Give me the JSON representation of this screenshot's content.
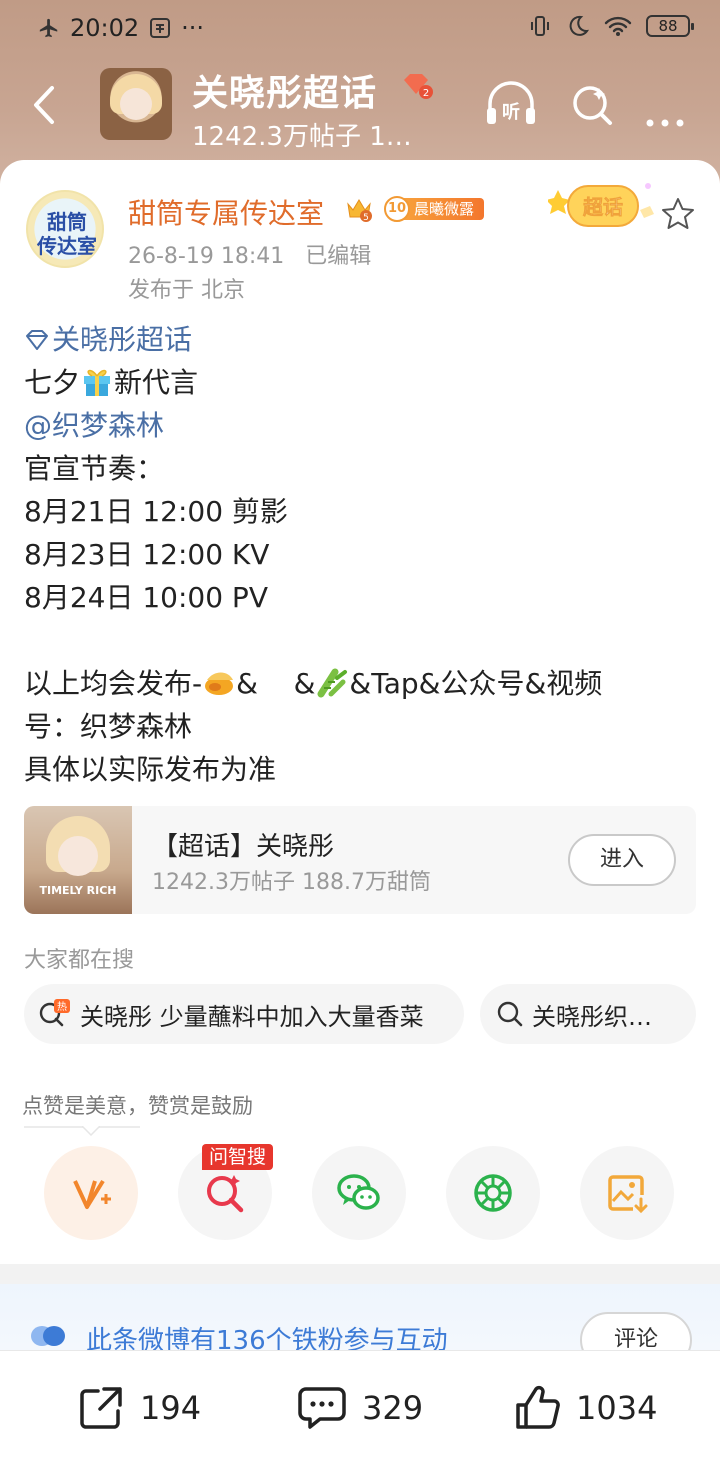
{
  "status_bar": {
    "time": "20:02",
    "dots": "···",
    "battery": "88"
  },
  "header": {
    "title": "关晓彤超话",
    "subtitle": "1242.3万帖子 1…",
    "badge_level": "2",
    "listen_label": "听"
  },
  "post": {
    "author": "甜筒专属传达室",
    "crown_level": "5",
    "level_num": "10",
    "level_text": "晨曦微露",
    "time": "26-8-19 18:41",
    "edited": "已编辑",
    "location": "发布于 北京",
    "sticker_text": "超话",
    "avatar_text_1": "甜筒",
    "avatar_text_2": "传达室",
    "lines": {
      "topic": "关晓彤超话",
      "l2a": "七夕",
      "l2b": "新代言",
      "mention": "@织梦森林",
      "l4": "官宣节奏：",
      "l5": "8月21日 12:00 剪影",
      "l6": "8月23日 12:00 KV",
      "l7": "8月24日 10:00 PV",
      "l9a": "以上均会发布-",
      "l9b": "&",
      "l9c": "&",
      "l9d": "&Tap&公众号&视频",
      "l10": "号：织梦森林",
      "l11": "具体以实际发布为准"
    }
  },
  "topic_card": {
    "title": "【超话】关晓彤",
    "stats": "1242.3万帖子 188.7万甜筒",
    "enter": "进入",
    "thumb_caption": "TIMELY RICH"
  },
  "search": {
    "label": "大家都在搜",
    "hot_badge": "热",
    "chips": [
      "关晓彤 少量蘸料中加入大量香菜",
      "关晓彤织…"
    ]
  },
  "actions": {
    "tip": "点赞是美意，赞赏是鼓励",
    "wenzhisou": "问智搜",
    "icons": [
      "reward-icon",
      "ai-search-icon",
      "wechat-icon",
      "moments-icon",
      "save-image-icon"
    ]
  },
  "fans_bar": {
    "text": "此条微博有136个铁粉参与互动",
    "button": "评论"
  },
  "bottom_bar": {
    "repost": "194",
    "comment": "329",
    "like": "1034"
  },
  "colors": {
    "accent_orange": "#e06c2b",
    "link_blue": "#4a6fa5",
    "fans_blue": "#3d7bd6",
    "red_badge": "#e7362d"
  }
}
